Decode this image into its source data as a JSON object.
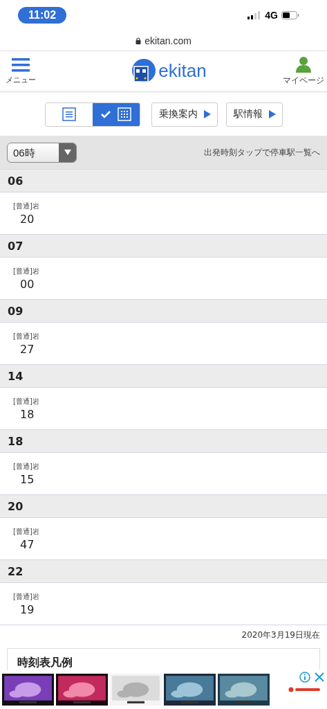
{
  "status_bar": {
    "time": "11:02",
    "network": "4G"
  },
  "url_bar": {
    "domain": "ekitan.com"
  },
  "header": {
    "menu_label": "メニュー",
    "logo_text": "ekitan",
    "mypage_label": "マイページ"
  },
  "view_toggle": [
    {
      "kind": "list",
      "selected": false
    },
    {
      "kind": "grid",
      "selected": true
    }
  ],
  "nav_buttons": [
    "乗換案内",
    "駅情報"
  ],
  "hour_select": {
    "value": "06時"
  },
  "hint": "出発時刻タップで停車駅一覧へ",
  "sections": [
    {
      "hour": "06",
      "trains": [
        {
          "type": "[普通]岩",
          "minute": "20"
        }
      ]
    },
    {
      "hour": "07",
      "trains": [
        {
          "type": "[普通]岩",
          "minute": "00"
        }
      ]
    },
    {
      "hour": "09",
      "trains": [
        {
          "type": "[普通]岩",
          "minute": "27"
        }
      ]
    },
    {
      "hour": "14",
      "trains": [
        {
          "type": "[普通]岩",
          "minute": "18"
        }
      ]
    },
    {
      "hour": "18",
      "trains": [
        {
          "type": "[普通]岩",
          "minute": "15"
        }
      ]
    },
    {
      "hour": "20",
      "trains": [
        {
          "type": "[普通]岩",
          "minute": "47"
        }
      ]
    },
    {
      "hour": "22",
      "trains": [
        {
          "type": "[普通]岩",
          "minute": "19"
        }
      ]
    }
  ],
  "as_of": "2020年3月19日現在",
  "legend": {
    "title": "時刻表凡例"
  }
}
